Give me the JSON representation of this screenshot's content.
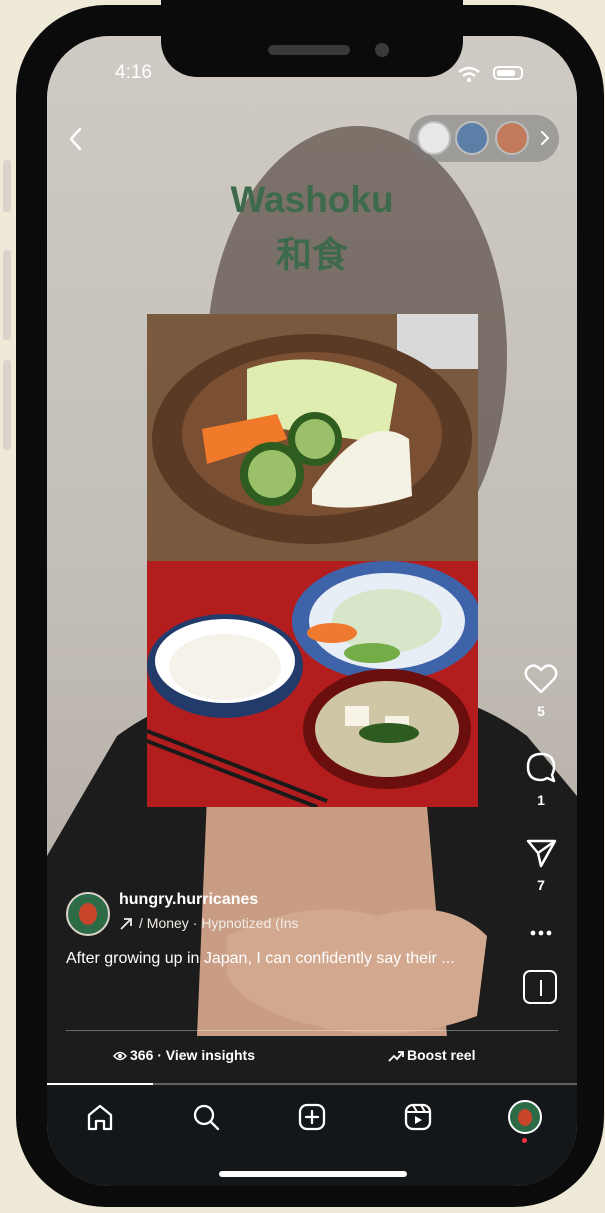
{
  "status_bar": {
    "time": "4:16"
  },
  "header": {
    "stories_count": 3
  },
  "post": {
    "title_en": "Washoku",
    "title_jp": "和食",
    "username": "hungry.hurricanes",
    "audio": "Money · Hypnotized (Ins",
    "caption": "After growing up in Japan, I can confidently say their ..."
  },
  "actions": {
    "likes": "5",
    "comments": "1",
    "shares": "7"
  },
  "footer": {
    "insights": "366 · View insights",
    "boost": "Boost reel"
  },
  "playback": {
    "progress": 0.2
  },
  "colors": {
    "title_green": "#3e6a4c",
    "tabbar_bg": "#14171a",
    "notification_dot": "#ff3040"
  },
  "tabs": [
    "home-icon",
    "search-icon",
    "create-icon",
    "reels-icon",
    "profile-avatar"
  ]
}
